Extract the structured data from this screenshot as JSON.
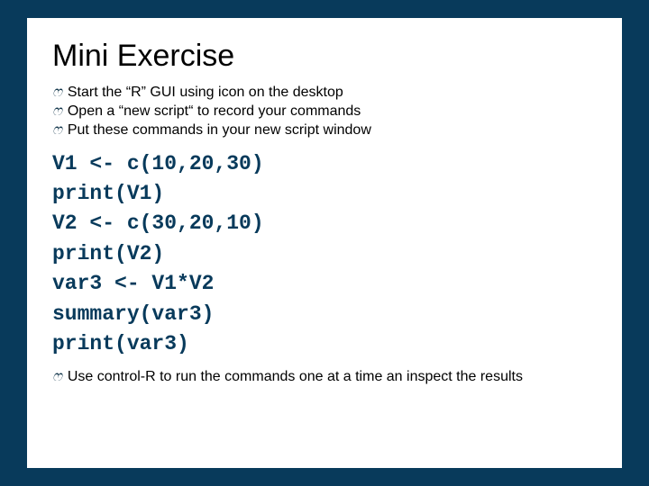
{
  "title": "Mini Exercise",
  "bullets": [
    "Start  the “R”  GUI using icon on the desktop",
    "Open a “new script“ to record your commands",
    "Put these commands in your new script window"
  ],
  "code": [
    "V1 <- c(10,20,30)",
    "print(V1)",
    "V2 <- c(30,20,10)",
    "print(V2)",
    "var3 <- V1*V2",
    "summary(var3)",
    "print(var3)"
  ],
  "after": [
    "Use control-R to run the commands one at a time an inspect the results"
  ],
  "bullet_glyph": "ෆ"
}
